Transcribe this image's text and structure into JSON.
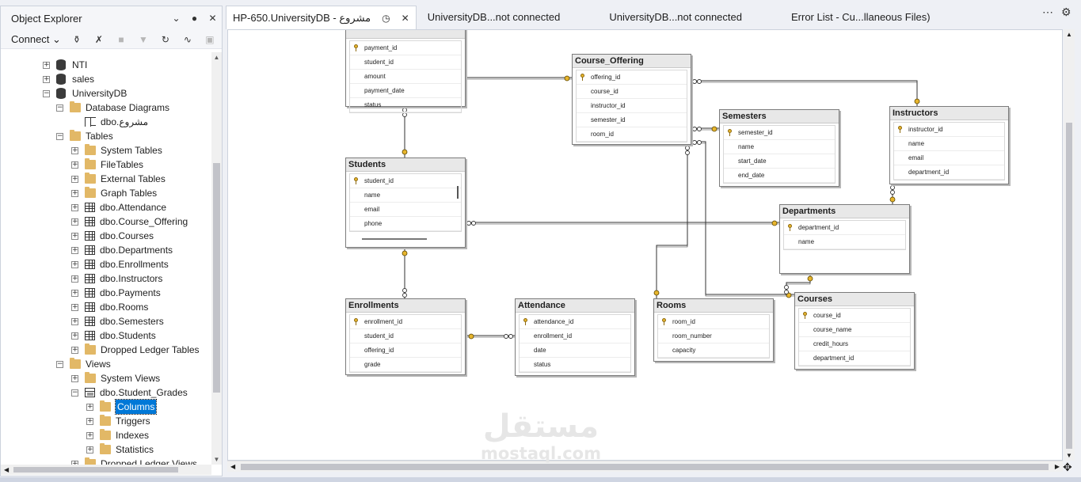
{
  "object_explorer": {
    "title": "Object Explorer",
    "connect_label": "Connect",
    "tree": [
      {
        "label": "NTI",
        "icon": "database-icon",
        "expander": "+"
      },
      {
        "label": "sales",
        "icon": "database-icon",
        "expander": "+"
      },
      {
        "label": "UniversityDB",
        "icon": "database-icon",
        "expander": "-"
      },
      {
        "label": "Database Diagrams",
        "icon": "folder-icon",
        "expander": "-"
      },
      {
        "label": "dbo.مشروع",
        "icon": "diagram-icon",
        "expander": ""
      },
      {
        "label": "Tables",
        "icon": "folder-icon",
        "expander": "-"
      },
      {
        "label": "System Tables",
        "icon": "folder-icon",
        "expander": "+"
      },
      {
        "label": "FileTables",
        "icon": "folder-icon",
        "expander": "+"
      },
      {
        "label": "External Tables",
        "icon": "folder-icon",
        "expander": "+"
      },
      {
        "label": "Graph Tables",
        "icon": "folder-icon",
        "expander": "+"
      },
      {
        "label": "dbo.Attendance",
        "icon": "table-icon",
        "expander": "+"
      },
      {
        "label": "dbo.Course_Offering",
        "icon": "table-icon",
        "expander": "+"
      },
      {
        "label": "dbo.Courses",
        "icon": "table-icon",
        "expander": "+"
      },
      {
        "label": "dbo.Departments",
        "icon": "table-icon",
        "expander": "+"
      },
      {
        "label": "dbo.Enrollments",
        "icon": "table-icon",
        "expander": "+"
      },
      {
        "label": "dbo.Instructors",
        "icon": "table-icon",
        "expander": "+"
      },
      {
        "label": "dbo.Payments",
        "icon": "table-icon",
        "expander": "+"
      },
      {
        "label": "dbo.Rooms",
        "icon": "table-icon",
        "expander": "+"
      },
      {
        "label": "dbo.Semesters",
        "icon": "table-icon",
        "expander": "+"
      },
      {
        "label": "dbo.Students",
        "icon": "table-icon",
        "expander": "+"
      },
      {
        "label": "Dropped Ledger Tables",
        "icon": "folder-icon",
        "expander": "+"
      },
      {
        "label": "Views",
        "icon": "folder-icon",
        "expander": "-"
      },
      {
        "label": "System Views",
        "icon": "folder-icon",
        "expander": "+"
      },
      {
        "label": "dbo.Student_Grades",
        "icon": "view-icon",
        "expander": "-"
      },
      {
        "label": "Columns",
        "icon": "folder-icon",
        "expander": "+",
        "selected": true
      },
      {
        "label": "Triggers",
        "icon": "folder-icon",
        "expander": "+"
      },
      {
        "label": "Indexes",
        "icon": "folder-icon",
        "expander": "+"
      },
      {
        "label": "Statistics",
        "icon": "folder-icon",
        "expander": "+"
      },
      {
        "label": "Dropped Ledger Views",
        "icon": "folder-icon",
        "expander": "+"
      }
    ]
  },
  "tabs": [
    {
      "label": "HP-650.UniversityDB - مشروع",
      "active": true
    },
    {
      "label": "UniversityDB...not connected",
      "active": false
    },
    {
      "label": "UniversityDB...not connected",
      "active": false
    },
    {
      "label": "Error List - Cu...llaneous Files)",
      "active": false
    }
  ],
  "diagram": {
    "tables": {
      "payments": {
        "title": "",
        "columns": [
          {
            "name": "payment_id",
            "pk": true
          },
          {
            "name": "student_id"
          },
          {
            "name": "amount"
          },
          {
            "name": "payment_date"
          },
          {
            "name": "status"
          }
        ]
      },
      "course_offering": {
        "title": "Course_Offering",
        "columns": [
          {
            "name": "offering_id",
            "pk": true
          },
          {
            "name": "course_id"
          },
          {
            "name": "instructor_id"
          },
          {
            "name": "semester_id"
          },
          {
            "name": "room_id"
          }
        ]
      },
      "semesters": {
        "title": "Semesters",
        "columns": [
          {
            "name": "semester_id",
            "pk": true
          },
          {
            "name": "name"
          },
          {
            "name": "start_date"
          },
          {
            "name": "end_date"
          }
        ]
      },
      "instructors": {
        "title": "Instructors",
        "columns": [
          {
            "name": "instructor_id",
            "pk": true
          },
          {
            "name": "name"
          },
          {
            "name": "email"
          },
          {
            "name": "department_id"
          }
        ]
      },
      "students": {
        "title": "Students",
        "columns": [
          {
            "name": "student_id",
            "pk": true
          },
          {
            "name": "name"
          },
          {
            "name": "email"
          },
          {
            "name": "phone"
          }
        ]
      },
      "departments": {
        "title": "Departments",
        "columns": [
          {
            "name": "department_id",
            "pk": true
          },
          {
            "name": "name"
          }
        ]
      },
      "enrollments": {
        "title": "Enrollments",
        "columns": [
          {
            "name": "enrollment_id",
            "pk": true
          },
          {
            "name": "student_id"
          },
          {
            "name": "offering_id"
          },
          {
            "name": "grade"
          }
        ]
      },
      "attendance": {
        "title": "Attendance",
        "columns": [
          {
            "name": "attendance_id",
            "pk": true
          },
          {
            "name": "enrollment_id"
          },
          {
            "name": "date"
          },
          {
            "name": "status"
          }
        ]
      },
      "rooms": {
        "title": "Rooms",
        "columns": [
          {
            "name": "room_id",
            "pk": true
          },
          {
            "name": "room_number"
          },
          {
            "name": "capacity"
          }
        ]
      },
      "courses": {
        "title": "Courses",
        "columns": [
          {
            "name": "course_id",
            "pk": true
          },
          {
            "name": "course_name"
          },
          {
            "name": "credit_hours"
          },
          {
            "name": "department_id"
          }
        ]
      }
    }
  },
  "watermark": {
    "arabic": "مستقل",
    "latin": "mostaql.com"
  },
  "colors": {
    "selection": "#0078d7",
    "key": "#e7b52d",
    "relationship_line": "#333333"
  }
}
